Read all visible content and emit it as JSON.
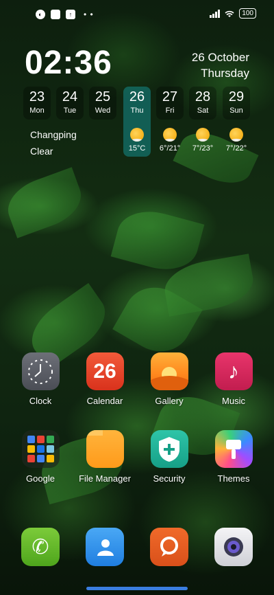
{
  "status_bar": {
    "left_icons": [
      "app-notification-icon",
      "square-icon",
      "upload-icon"
    ],
    "battery": "100"
  },
  "clock": {
    "time": "02:36",
    "date": "26 October",
    "weekday": "Thursday"
  },
  "week": [
    {
      "num": "23",
      "name": "Mon",
      "today": false
    },
    {
      "num": "24",
      "name": "Tue",
      "today": false
    },
    {
      "num": "25",
      "name": "Wed",
      "today": false
    },
    {
      "num": "26",
      "name": "Thu",
      "today": true
    },
    {
      "num": "27",
      "name": "Fri",
      "today": false
    },
    {
      "num": "28",
      "name": "Sat",
      "today": false
    },
    {
      "num": "29",
      "name": "Sun",
      "today": false
    }
  ],
  "weather": {
    "location": "Changping",
    "condition": "Clear",
    "forecast": [
      {
        "temp": "15°C",
        "icon": "sunny-icon"
      },
      {
        "temp": "6°/21°",
        "icon": "sunny-icon"
      },
      {
        "temp": "7°/23°",
        "icon": "sunny-icon"
      },
      {
        "temp": "7°/22°",
        "icon": "sunny-icon"
      }
    ]
  },
  "apps": {
    "clock": "Clock",
    "calendar": "Calendar",
    "calendar_day": "26",
    "gallery": "Gallery",
    "music": "Music",
    "google": "Google",
    "file_manager": "File Manager",
    "security": "Security",
    "themes": "Themes"
  },
  "dock": [
    "phone-icon",
    "contacts-icon",
    "messages-icon",
    "camera-icon"
  ]
}
